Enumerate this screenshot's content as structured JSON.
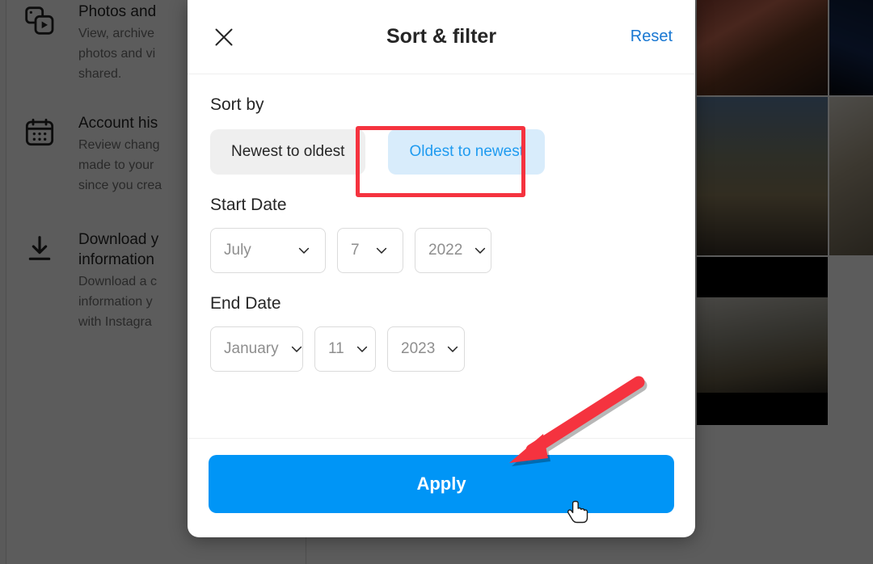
{
  "background": {
    "items": [
      {
        "icon": "photos-videos-icon",
        "title": "Photos and ",
        "desc": "View, archive \nphotos and vi\nshared."
      },
      {
        "icon": "calendar-icon",
        "title": "Account his",
        "desc": "Review chang\nmade to your \nsince you crea"
      },
      {
        "icon": "download-icon",
        "title": "Download y\ninformation",
        "desc": "Download a c\ninformation y\nwith Instagra"
      }
    ]
  },
  "modal": {
    "title": "Sort & filter",
    "close_icon": "close-icon",
    "reset_label": "Reset",
    "sort": {
      "label": "Sort by",
      "options": [
        {
          "label": "Newest to oldest",
          "selected": false
        },
        {
          "label": "Oldest to newest",
          "selected": true
        }
      ]
    },
    "start_date": {
      "label": "Start Date",
      "month": "July",
      "day": "7",
      "year": "2022"
    },
    "end_date": {
      "label": "End Date",
      "month": "January",
      "day": "11",
      "year": "2023"
    },
    "apply_label": "Apply"
  },
  "annotations": {
    "highlight_color": "#f5333f",
    "arrow_color": "#f5333f",
    "highlight_target": "Oldest to newest",
    "arrow_target": "Apply"
  },
  "colors": {
    "accent_blue": "#0095f6",
    "link_blue": "#1877d2",
    "selected_pill_bg": "#d8ecfb",
    "selected_pill_text": "#1f9bf0",
    "unselected_pill_bg": "#efefef",
    "border_gray": "#dbdbdb",
    "text_primary": "#262626",
    "text_secondary": "#8e8e8e"
  }
}
